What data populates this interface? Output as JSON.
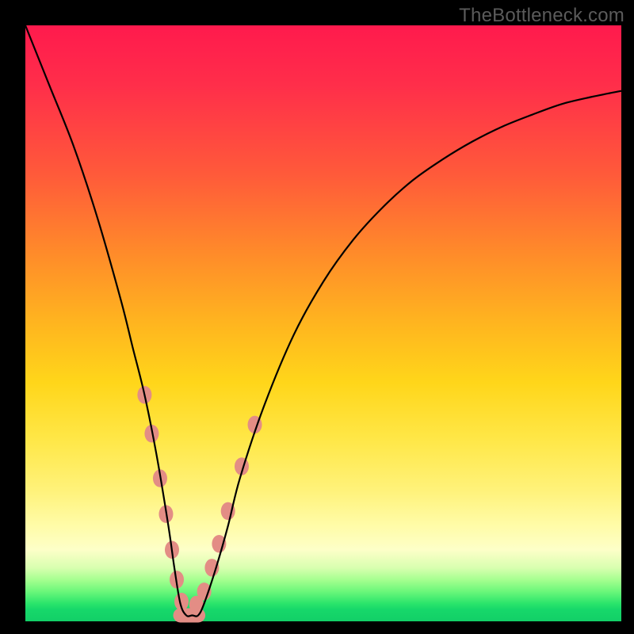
{
  "watermark": "TheBottleneck.com",
  "chart_data": {
    "type": "line",
    "title": "",
    "xlabel": "",
    "ylabel": "",
    "xlim": [
      0,
      100
    ],
    "ylim": [
      0,
      100
    ],
    "grid": false,
    "legend": false,
    "series": [
      {
        "name": "bottleneck-curve",
        "color": "#000000",
        "x": [
          0,
          4,
          8,
          12,
          16,
          18,
          20,
          22,
          24,
          25,
          26,
          27,
          28,
          29,
          30,
          32,
          34,
          36,
          40,
          45,
          50,
          55,
          60,
          65,
          70,
          75,
          80,
          85,
          90,
          95,
          100
        ],
        "values": [
          100,
          90,
          80,
          68,
          54,
          46,
          38,
          28,
          16,
          9,
          3,
          1,
          1,
          1,
          3,
          9,
          16,
          24,
          36,
          48,
          57,
          64,
          69.5,
          74,
          77.5,
          80.5,
          83,
          85,
          86.8,
          88,
          89
        ]
      }
    ],
    "markers": [
      {
        "name": "highlight-dots",
        "color": "#e38d85",
        "radius_px": 9,
        "elongated": 1.25,
        "points": [
          {
            "x": 20.0,
            "y": 38.0
          },
          {
            "x": 21.2,
            "y": 31.5
          },
          {
            "x": 22.6,
            "y": 24.0
          },
          {
            "x": 23.6,
            "y": 18.0
          },
          {
            "x": 24.6,
            "y": 12.0
          },
          {
            "x": 25.4,
            "y": 7.0
          },
          {
            "x": 26.2,
            "y": 3.3
          },
          {
            "x": 28.7,
            "y": 2.8
          },
          {
            "x": 30.0,
            "y": 5.0
          },
          {
            "x": 31.3,
            "y": 9.0
          },
          {
            "x": 32.5,
            "y": 13.0
          },
          {
            "x": 34.0,
            "y": 18.5
          },
          {
            "x": 36.3,
            "y": 26.0
          },
          {
            "x": 38.5,
            "y": 33.0
          }
        ]
      },
      {
        "name": "bottom-pill",
        "color": "#e38d85",
        "shape": "pill",
        "points": [
          {
            "x0": 26.0,
            "x1": 29.0,
            "y": 1.0
          }
        ]
      }
    ]
  }
}
